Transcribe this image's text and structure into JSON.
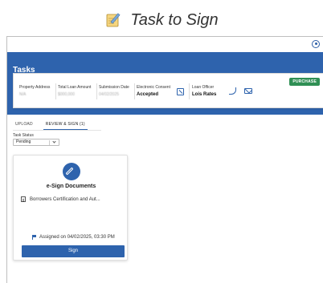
{
  "page_title": "Task to Sign",
  "app": {
    "section_title": "Tasks",
    "badge": "PURCHASE",
    "fields": {
      "property_address": {
        "label": "Property Address",
        "value": "N/A"
      },
      "total_loan_amount": {
        "label": "Total Loan Amount",
        "value": "$000,000"
      },
      "submission_date": {
        "label": "Submission Date",
        "value": "04/02/2025"
      },
      "electronic_consent": {
        "label": "Electronic Consent",
        "value": "Accepted"
      },
      "loan_officer": {
        "label": "Loan Officer",
        "value": "Lois Rates"
      }
    },
    "tabs": [
      {
        "label": "UPLOAD",
        "active": false
      },
      {
        "label": "REVIEW & SIGN (1)",
        "active": true
      }
    ],
    "task_status": {
      "label": "Task Status",
      "selected": "Pending"
    },
    "card": {
      "title": "e-Sign Documents",
      "document": "Borrowers Certification and Aut...",
      "assigned": "Assigned on 04/02/2025, 03:30 PM",
      "button": "Sign"
    }
  },
  "icons": {
    "heading": "notepad-pencil-icon",
    "user": "user-circle-icon",
    "consent": "checkbox-pen-icon",
    "phone": "phone-icon",
    "mail": "mail-icon",
    "card": "pencil-icon",
    "document": "document-icon",
    "assigned": "flag-icon"
  },
  "colors": {
    "primary": "#2e63ad",
    "badge": "#2f8f54"
  }
}
